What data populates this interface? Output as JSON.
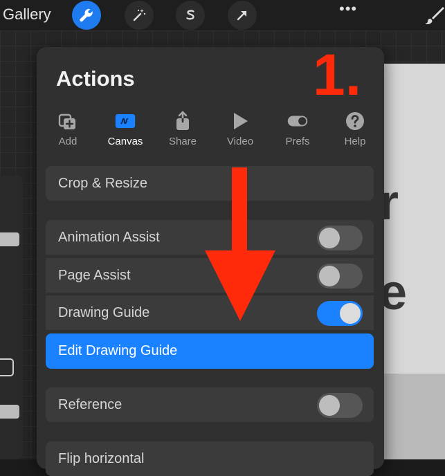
{
  "topbar": {
    "gallery_label": "Gallery",
    "more_label": "•••",
    "tools": [
      {
        "name": "wrench-icon",
        "active": true
      },
      {
        "name": "magic-wand-icon",
        "active": false
      },
      {
        "name": "selection-s-icon",
        "active": false
      },
      {
        "name": "transform-arrow-icon",
        "active": false
      }
    ]
  },
  "panel": {
    "title": "Actions",
    "tabs": [
      {
        "label": "Add",
        "icon": "add-image-icon"
      },
      {
        "label": "Canvas",
        "icon": "canvas-icon",
        "active": true
      },
      {
        "label": "Share",
        "icon": "share-icon"
      },
      {
        "label": "Video",
        "icon": "play-icon"
      },
      {
        "label": "Prefs",
        "icon": "toggle-icon"
      },
      {
        "label": "Help",
        "icon": "help-icon"
      }
    ],
    "items": {
      "crop": "Crop & Resize",
      "animation": {
        "label": "Animation Assist",
        "on": false
      },
      "page": {
        "label": "Page Assist",
        "on": false
      },
      "guide": {
        "label": "Drawing Guide",
        "on": true
      },
      "edit_guide": "Edit Drawing Guide",
      "reference": {
        "label": "Reference",
        "on": false
      },
      "flip": "Flip horizontal"
    }
  },
  "annotation": {
    "step": "1.",
    "color": "#ff2a0a"
  },
  "colors": {
    "accent": "#1a82ff"
  }
}
